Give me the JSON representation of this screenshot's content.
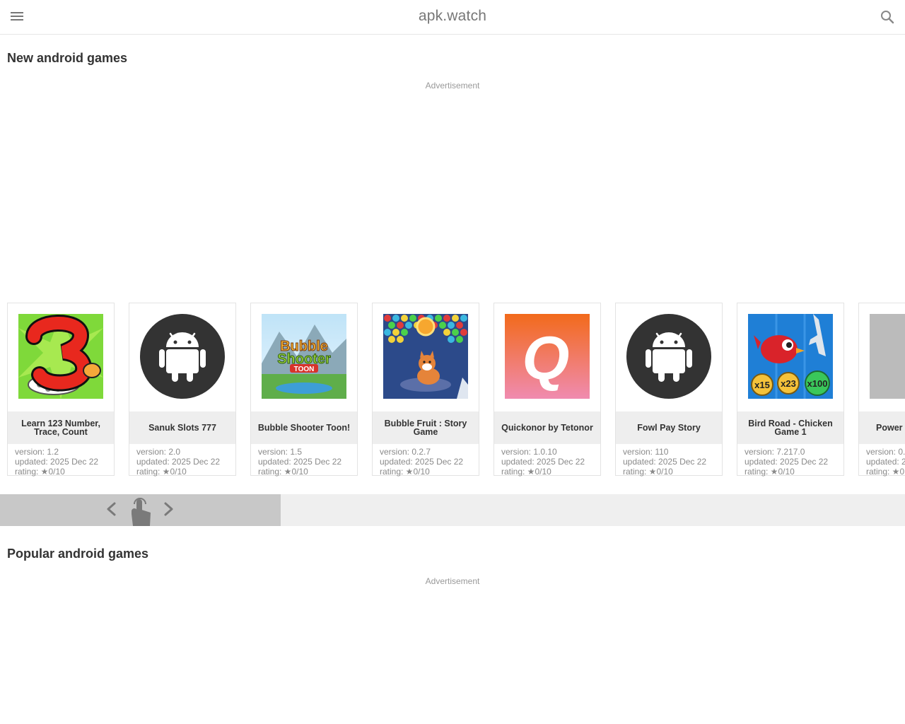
{
  "header": {
    "title": "apk.watch"
  },
  "sections": [
    {
      "title": "New android games",
      "ad_label": "Advertisement"
    },
    {
      "title": "Popular android games",
      "ad_label": "Advertisement"
    }
  ],
  "games": [
    {
      "name": "Learn 123 Number, Trace, Count",
      "version": "version: 1.2",
      "updated": "updated: 2025 Dec 22",
      "rating": "rating: ★0/10",
      "icon": "number-three-icon"
    },
    {
      "name": "Sanuk Slots 777",
      "version": "version: 2.0",
      "updated": "updated: 2025 Dec 22",
      "rating": "rating: ★0/10",
      "icon": "android-icon"
    },
    {
      "name": "Bubble Shooter Toon!",
      "version": "version: 1.5",
      "updated": "updated: 2025 Dec 22",
      "rating": "rating: ★0/10",
      "icon": "bubble-shooter-toon-icon"
    },
    {
      "name": "Bubble Fruit : Story Game",
      "version": "version: 0.2.7",
      "updated": "updated: 2025 Dec 22",
      "rating": "rating: ★0/10",
      "icon": "bubble-fruit-icon"
    },
    {
      "name": "Quickonor by Tetonor",
      "version": "version: 1.0.10",
      "updated": "updated: 2025 Dec 22",
      "rating": "rating: ★0/10",
      "icon": "quickonor-q-icon"
    },
    {
      "name": "Fowl Pay Story",
      "version": "version: 110",
      "updated": "updated: 2025 Dec 22",
      "rating": "rating: ★0/10",
      "icon": "android-icon"
    },
    {
      "name": "Bird Road - Chicken Game 1",
      "version": "version: 7.217.0",
      "updated": "updated: 2025 Dec 22",
      "rating": "rating: ★0/10",
      "icon": "bird-road-icon"
    },
    {
      "name": "Power S",
      "version": "version: 0.",
      "updated": "updated: 2",
      "rating": "rating: ★0",
      "icon": "placeholder-icon"
    }
  ],
  "icon_text": {
    "bubble_line1": "Bubble",
    "bubble_line2": "Shooter",
    "bubble_line3": "TOON",
    "quick_letter": "Q",
    "bird_x15": "x15",
    "bird_x23": "x23",
    "bird_x100": "x100"
  },
  "colors": {
    "android_circle": "#333333",
    "quick_bg_top": "#f26a1b",
    "quick_bg_bottom": "#f08bb0",
    "bird_bg": "#1f7fd6"
  }
}
